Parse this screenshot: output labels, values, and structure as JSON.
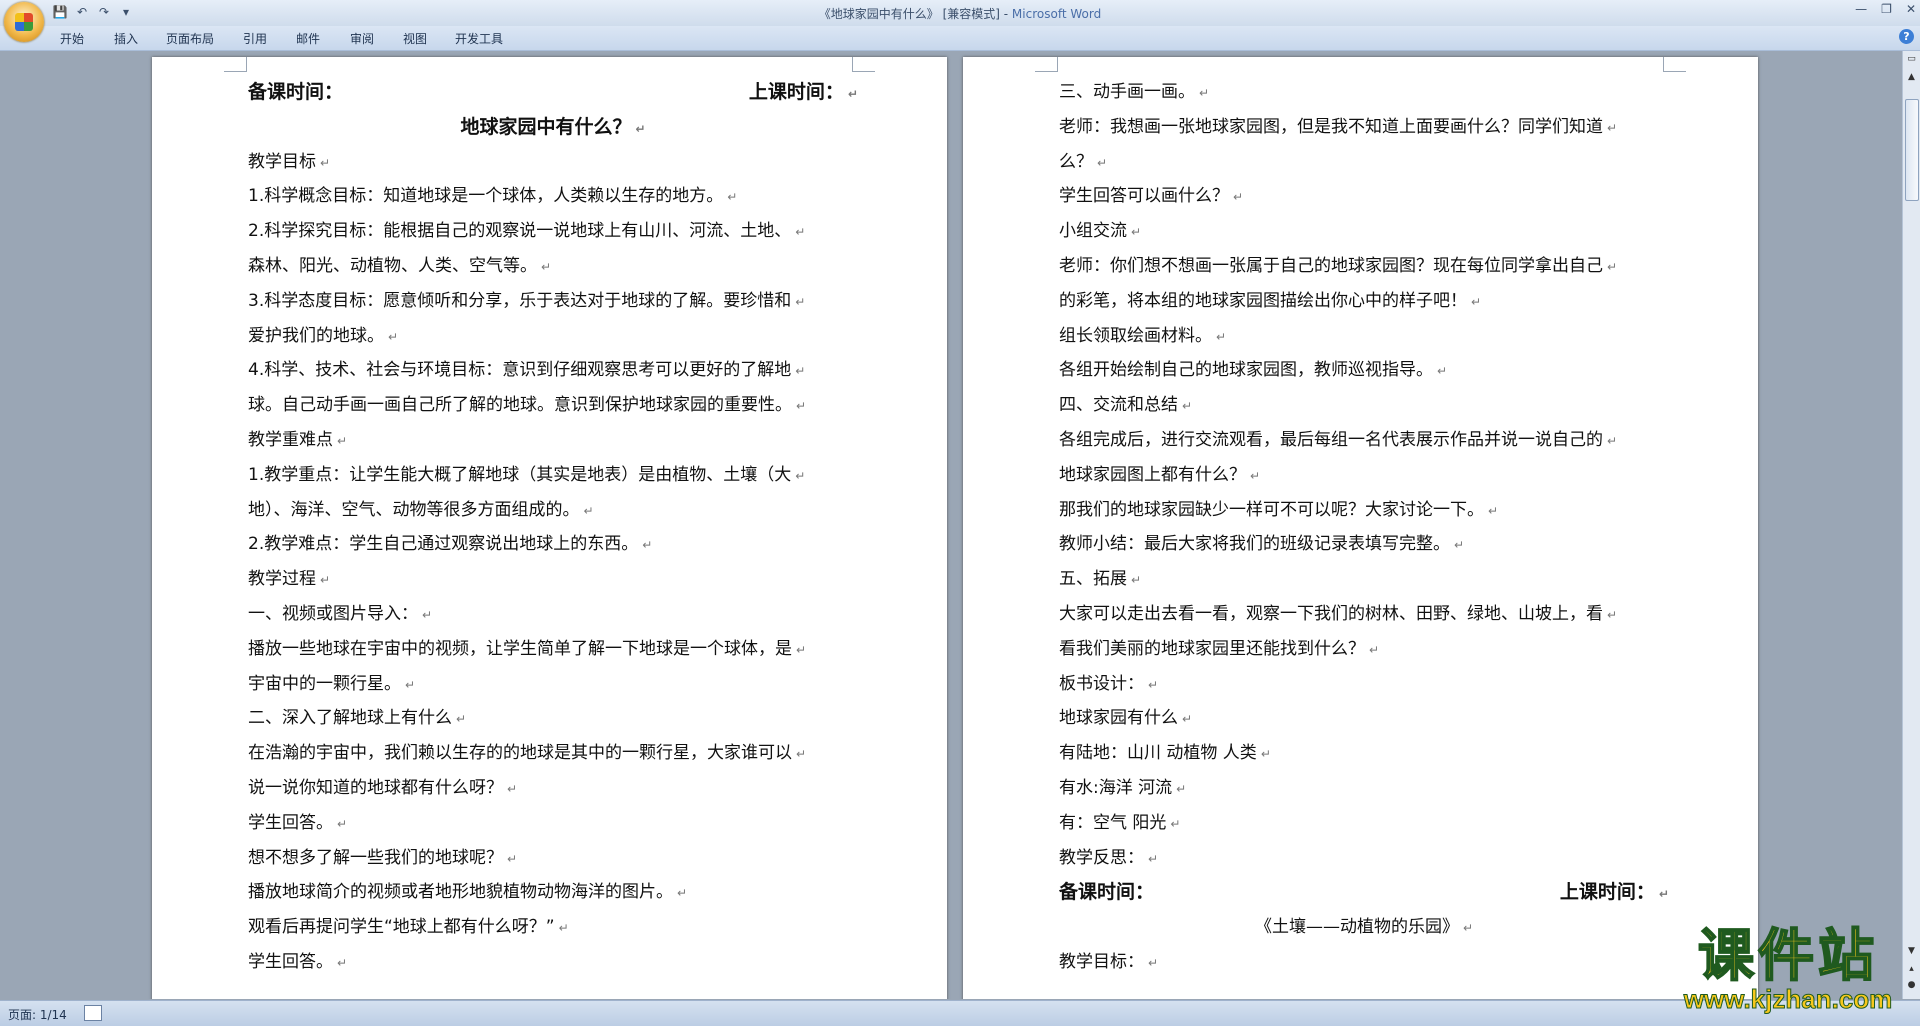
{
  "window": {
    "title": "《地球家园中有什么》 [兼容模式] - ",
    "app_name": "Microsoft Word",
    "controls": [
      "—",
      "❐",
      "✕"
    ]
  },
  "ribbon": {
    "tabs": [
      "开始",
      "插入",
      "页面布局",
      "引用",
      "邮件",
      "审阅",
      "视图",
      "开发工具"
    ],
    "help": "?"
  },
  "qat": {
    "save": "💾",
    "undo": "↶",
    "redo": "↷",
    "more": "▾"
  },
  "left_page": {
    "meta": {
      "prep_time": "备课时间：",
      "class_time": "上课时间："
    },
    "title": "地球家园中有什么？",
    "lines": [
      "教学目标",
      "1.科学概念目标：知道地球是一个球体，人类赖以生存的地方。",
      "2.科学探究目标：能根据自己的观察说一说地球上有山川、河流、土地、",
      "森林、阳光、动植物、人类、空气等。",
      "3.科学态度目标：愿意倾听和分享，乐于表达对于地球的了解。要珍惜和",
      "爱护我们的地球。",
      "4.科学、技术、社会与环境目标：意识到仔细观察思考可以更好的了解地",
      "球。自己动手画一画自己所了解的地球。意识到保护地球家园的重要性。",
      "教学重难点",
      "1.教学重点：让学生能大概了解地球（其实是地表）是由植物、土壤（大",
      "地）、海洋、空气、动物等很多方面组成的。",
      "2.教学难点：学生自己通过观察说出地球上的东西。",
      "教学过程",
      " 一、视频或图片导入：",
      "播放一些地球在宇宙中的视频，让学生简单了解一下地球是一个球体，是",
      "宇宙中的一颗行星。",
      "二、深入了解地球上有什么",
      "在浩瀚的宇宙中，我们赖以生存的的地球是其中的一颗行星，大家谁可以",
      "说一说你知道的地球都有什么呀？",
      "学生回答。",
      "想不想多了解一些我们的地球呢？",
      "播放地球简介的视频或者地形地貌植物动物海洋的图片。",
      "观看后再提问学生“地球上都有什么呀？”",
      "学生回答。"
    ]
  },
  "right_page": {
    "lines_top": [
      " 三、动手画一画。",
      "老师：我想画一张地球家园图，但是我不知道上面要画什么？同学们知道",
      "么？",
      "学生回答可以画什么？",
      "小组交流",
      "老师：你们想不想画一张属于自己的地球家园图？现在每位同学拿出自己",
      "的彩笔，将本组的地球家园图描绘出你心中的样子吧！",
      "组长领取绘画材料。",
      "各组开始绘制自己的地球家园图，教师巡视指导。",
      "四、交流和总结",
      "各组完成后，进行交流观看，最后每组一名代表展示作品并说一说自己的",
      "地球家园图上都有什么？",
      "那我们的地球家园缺少一样可不可以呢？大家讨论一下。",
      "教师小结：最后大家将我们的班级记录表填写完整。",
      "五、拓展",
      "大家可以走出去看一看，观察一下我们的树林、田野、绿地、山坡上，看",
      "看我们美丽的地球家园里还能找到什么？",
      "板书设计：",
      "     地球家园有什么",
      "      有陆地：山川 动植物 人类",
      "     有水:海洋 河流",
      "     有：空气 阳光",
      "教学反思："
    ],
    "meta": {
      "prep_time": "备课时间：",
      "class_time": "上课时间："
    },
    "next_title": "《土壤——动植物的乐园》",
    "next_line": "教学目标："
  },
  "paragraph_mark": "↵",
  "status": {
    "page": "页面: 1/14"
  },
  "watermark": {
    "text": "课件站",
    "url": "www.kjzhan.com"
  }
}
